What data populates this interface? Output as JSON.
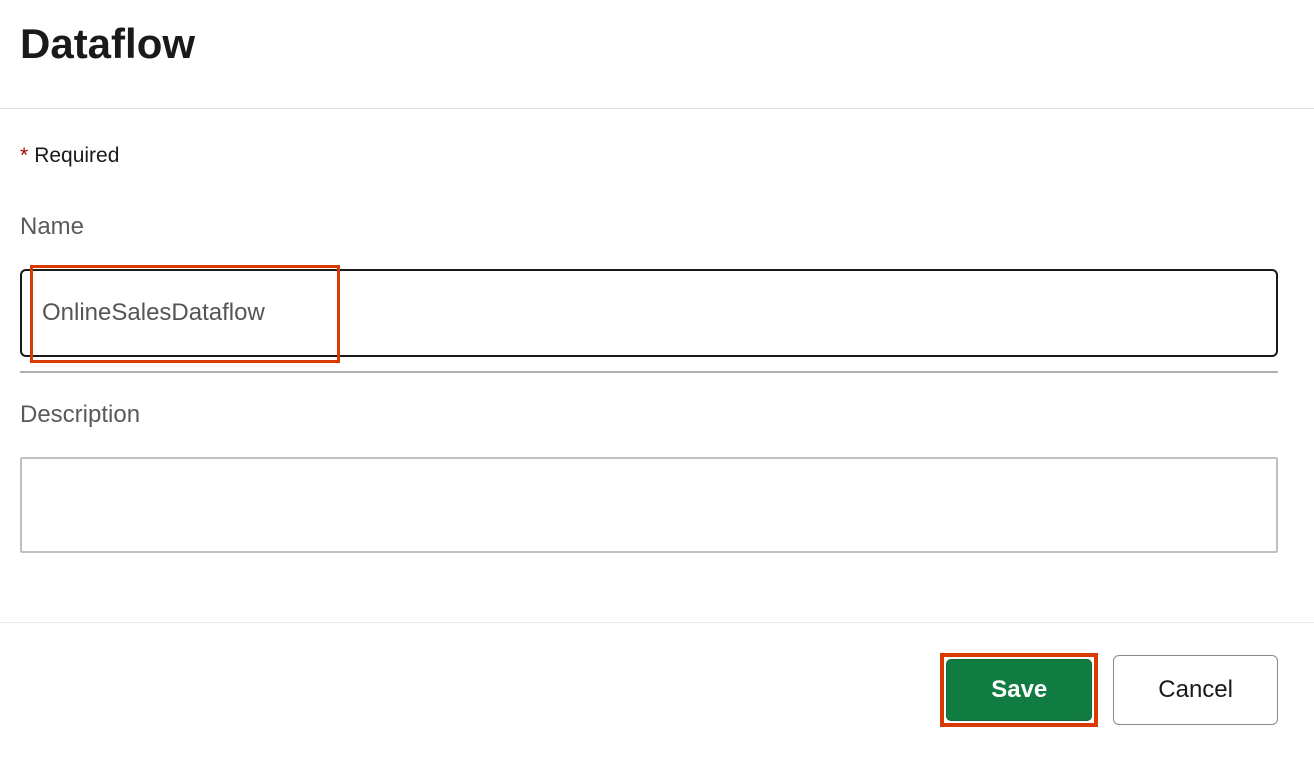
{
  "header": {
    "title": "Dataflow"
  },
  "form": {
    "required_asterisk": "*",
    "required_label": "Required",
    "name_label": "Name",
    "name_value": "OnlineSalesDataflow",
    "description_label": "Description",
    "description_value": ""
  },
  "actions": {
    "save_label": "Save",
    "cancel_label": "Cancel"
  },
  "colors": {
    "highlight": "#d83b01",
    "primary": "#107c41"
  }
}
